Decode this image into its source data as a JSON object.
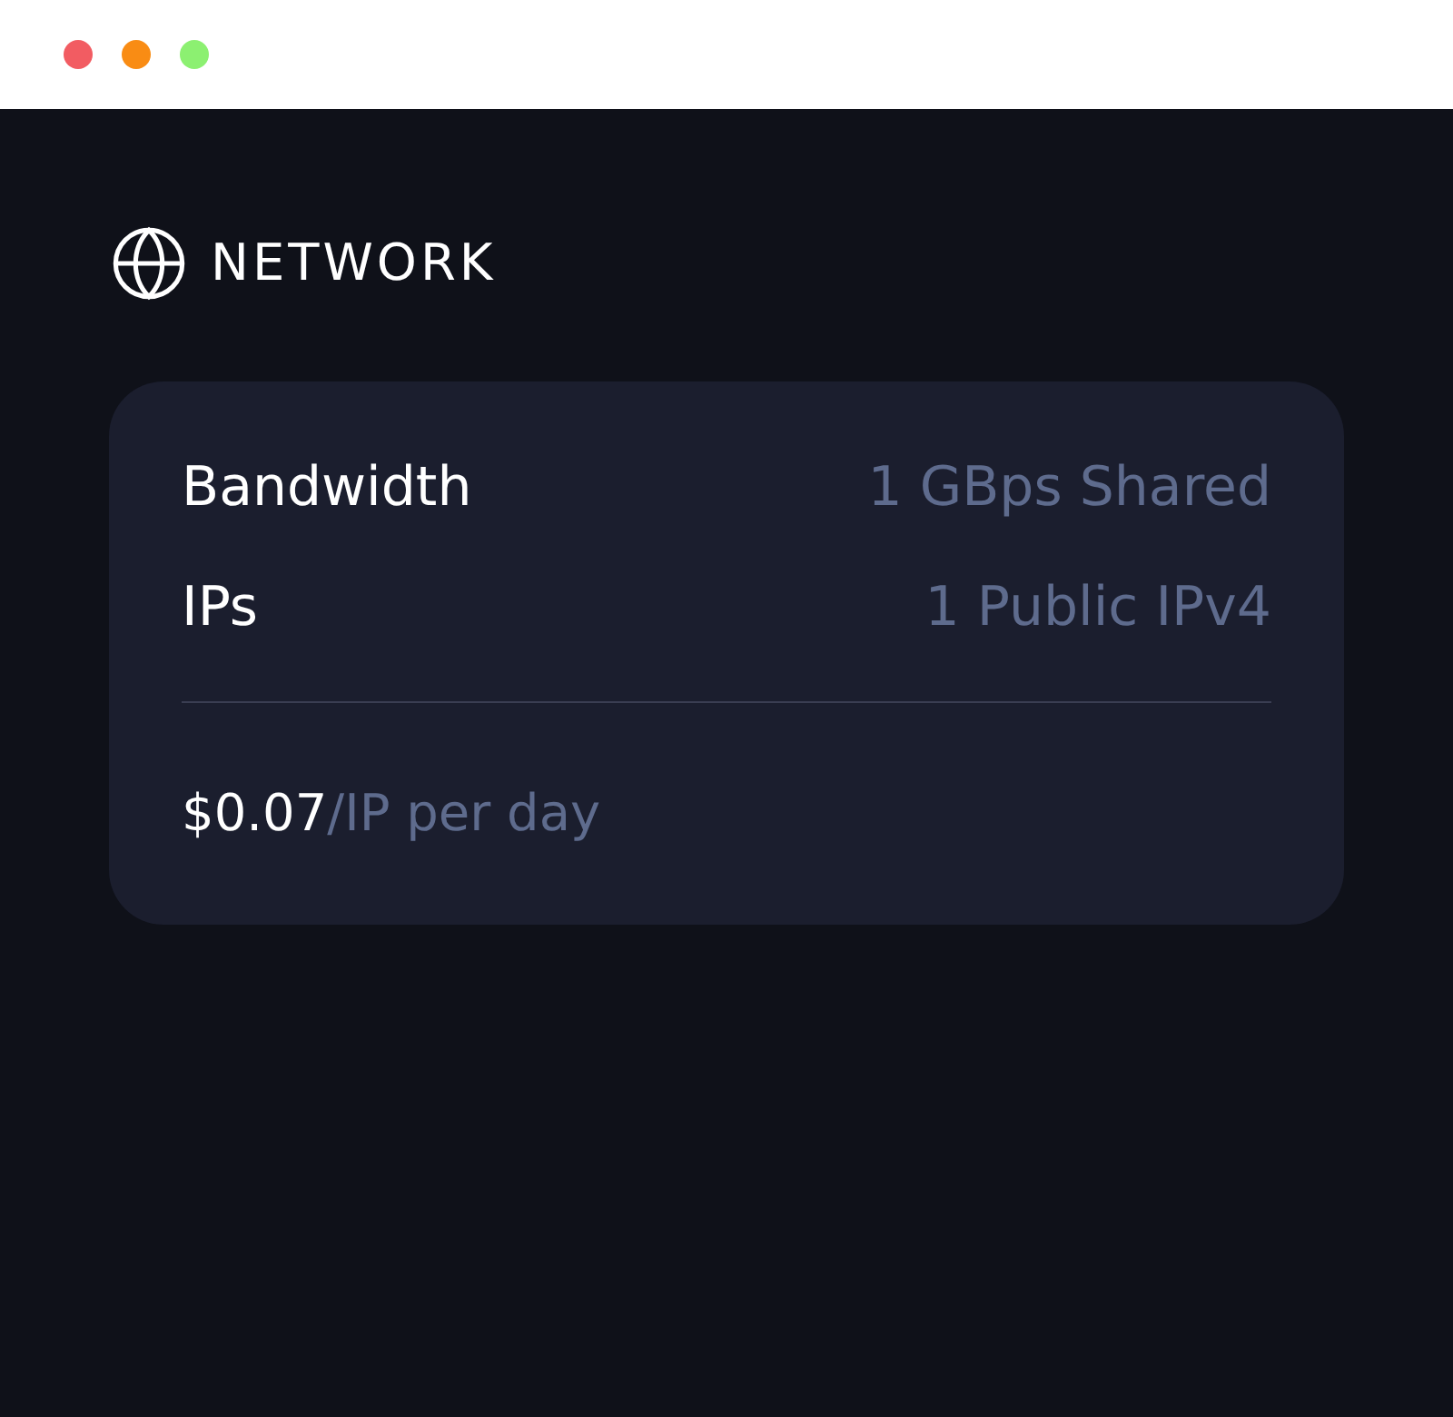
{
  "section": {
    "title": "NETWORK"
  },
  "specs": [
    {
      "label": "Bandwidth",
      "value": "1 GBps Shared"
    },
    {
      "label": "IPs",
      "value": "1 Public IPv4"
    }
  ],
  "price": {
    "amount": "$0.07",
    "unit": "/IP per day"
  }
}
